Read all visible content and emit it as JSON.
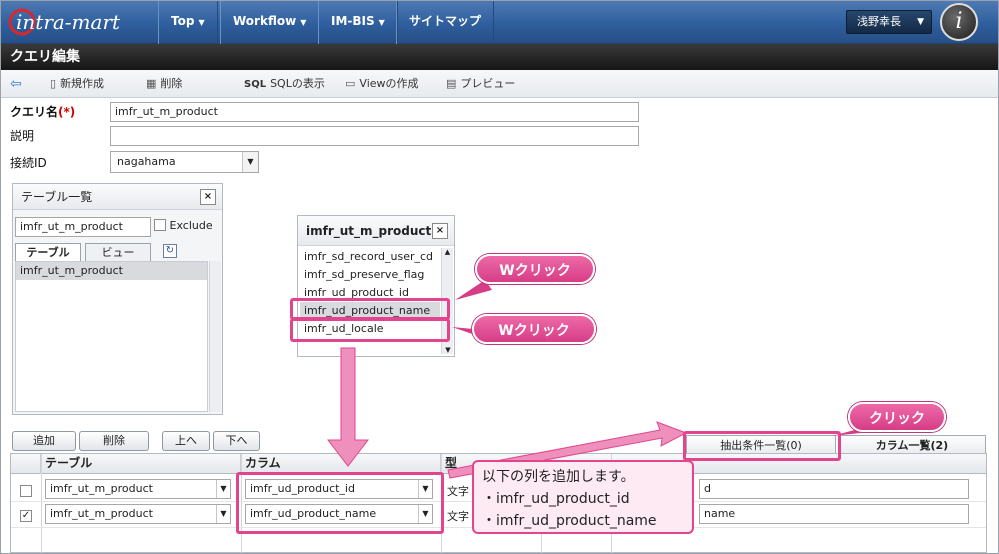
{
  "header": {
    "logo_text": "intra-mart",
    "nav": [
      {
        "label": "Top",
        "caret": "▼"
      },
      {
        "label": "Workflow",
        "caret": "▼"
      },
      {
        "label": "IM-BIS",
        "caret": "▼"
      },
      {
        "label": "サイトマップ"
      }
    ],
    "user_name": "浅野幸長",
    "user_caret": "▼",
    "badge_letter": "i"
  },
  "page": {
    "title": "クエリ編集"
  },
  "toolbar": {
    "new": "新規作成",
    "delete": "削除",
    "sql_icon": "SQL",
    "sql": "SQLの表示",
    "view": "Viewの作成",
    "preview": "プレビュー"
  },
  "form": {
    "query_name_label": "クエリ名",
    "required_mark": "(*)",
    "query_name_value": "imfr_ut_m_product",
    "description_label": "説明",
    "description_value": "",
    "connection_label": "接続ID",
    "connection_value": "nagahama"
  },
  "table_panel": {
    "title": "テーブル一覧",
    "search_value": "imfr_ut_m_product",
    "exclude_label": "Exclude",
    "tabs": [
      "テーブル",
      "ビュー"
    ],
    "items": [
      "imfr_ut_m_product"
    ]
  },
  "column_popup": {
    "title": "imfr_ut_m_product",
    "items": [
      "imfr_sd_record_user_cd",
      "imfr_sd_preserve_flag",
      "imfr_ud_product_id",
      "imfr_ud_product_name",
      "imfr_ud_locale"
    ]
  },
  "buttons": {
    "add": "追加",
    "delete": "削除",
    "up": "上へ",
    "down": "下へ"
  },
  "right_tabs": {
    "conditions": "抽出条件一覧(0)",
    "columns": "カラム一覧(2)"
  },
  "grid": {
    "headers": {
      "table": "テーブル",
      "column": "カラム",
      "type": "型"
    },
    "rows": [
      {
        "checked": false,
        "table": "imfr_ut_m_product",
        "column": "imfr_ud_product_id",
        "type": "文字",
        "alias": "d"
      },
      {
        "checked": true,
        "table": "imfr_ut_m_product",
        "column": "imfr_ud_product_name",
        "type": "文字",
        "alias": "name"
      }
    ]
  },
  "annotations": {
    "dblclick": "Wクリック",
    "click": "クリック",
    "note_title": "以下の列を追加します。",
    "note_items": [
      "・imfr_ud_product_id",
      "・imfr_ud_product_name"
    ],
    "accent_color": "#e2458d"
  }
}
